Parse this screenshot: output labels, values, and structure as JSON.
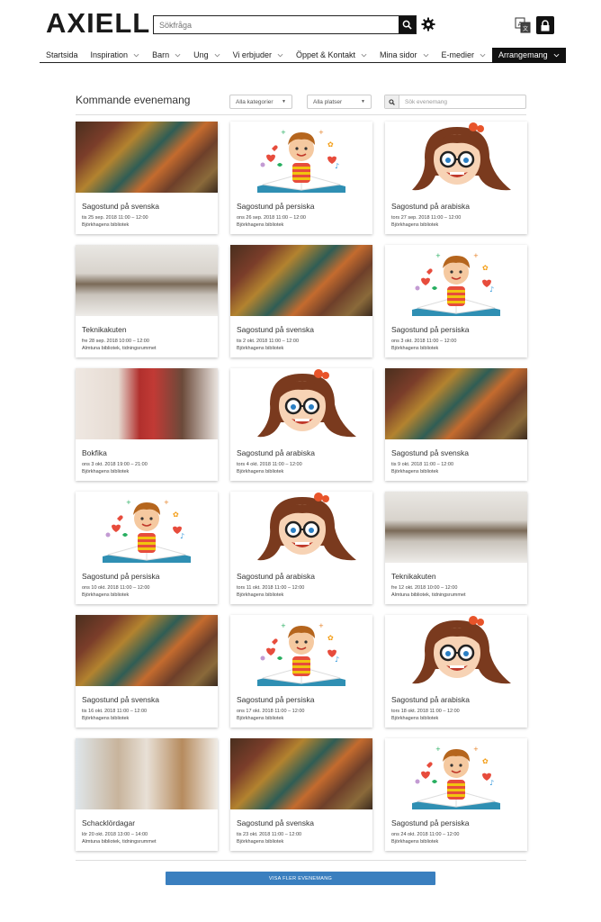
{
  "header": {
    "logo_text": "AXIELL",
    "search_placeholder": "Sökfråga",
    "icons": {
      "search": "search-icon",
      "settings": "gear-icon",
      "translate": "translate-icon",
      "login": "lock-icon"
    }
  },
  "nav": [
    {
      "label": "Startsida",
      "dropdown": false,
      "active": false
    },
    {
      "label": "Inspiration",
      "dropdown": true,
      "active": false
    },
    {
      "label": "Barn",
      "dropdown": true,
      "active": false
    },
    {
      "label": "Ung",
      "dropdown": true,
      "active": false
    },
    {
      "label": "Vi erbjuder",
      "dropdown": true,
      "active": false
    },
    {
      "label": "Öppet & Kontakt",
      "dropdown": true,
      "active": false
    },
    {
      "label": "Mina sidor",
      "dropdown": true,
      "active": false
    },
    {
      "label": "E-medier",
      "dropdown": true,
      "active": false
    },
    {
      "label": "Arrangemang",
      "dropdown": true,
      "active": true
    }
  ],
  "events": {
    "title": "Kommande evenemang",
    "filter_category": "Alla kategorier",
    "filter_place": "Alla platser",
    "search_placeholder": "Sök evenemang",
    "more_button": "VISA FLER EVENEMANG",
    "items": [
      {
        "title": "Sagostund på svenska",
        "date": "tis 25 sep. 2018 11:00 – 12:00",
        "place": "Björkhagens bibliotek",
        "image": "books"
      },
      {
        "title": "Sagostund på persiska",
        "date": "ons 26 sep. 2018 11:00 – 12:00",
        "place": "Björkhagens bibliotek",
        "image": "boy"
      },
      {
        "title": "Sagostund på arabiska",
        "date": "tors 27 sep. 2018 11:00 – 12:00",
        "place": "Björkhagens bibliotek",
        "image": "girl"
      },
      {
        "title": "Teknikakuten",
        "date": "fre 28 sep. 2018 10:00 – 12:00",
        "place": "Almtuna bibliotek, tidningsrummet",
        "image": "tech"
      },
      {
        "title": "Sagostund på svenska",
        "date": "tis 2 okt. 2018 11:00 – 12:00",
        "place": "Björkhagens bibliotek",
        "image": "books"
      },
      {
        "title": "Sagostund på persiska",
        "date": "ons 3 okt. 2018 11:00 – 12:00",
        "place": "Björkhagens bibliotek",
        "image": "boy"
      },
      {
        "title": "Bokfika",
        "date": "ons 3 okt. 2018 19:00 – 21:00",
        "place": "Björkhagens bibliotek",
        "image": "portrait"
      },
      {
        "title": "Sagostund på arabiska",
        "date": "tors 4 okt. 2018 11:00 – 12:00",
        "place": "Björkhagens bibliotek",
        "image": "girl"
      },
      {
        "title": "Sagostund på svenska",
        "date": "tis 9 okt. 2018 11:00 – 12:00",
        "place": "Björkhagens bibliotek",
        "image": "books"
      },
      {
        "title": "Sagostund på persiska",
        "date": "ons 10 okt. 2018 11:00 – 12:00",
        "place": "Björkhagens bibliotek",
        "image": "boy"
      },
      {
        "title": "Sagostund på arabiska",
        "date": "tors 11 okt. 2018 11:00 – 12:00",
        "place": "Björkhagens bibliotek",
        "image": "girl"
      },
      {
        "title": "Teknikakuten",
        "date": "fre 12 okt. 2018 10:00 – 12:00",
        "place": "Almtuna bibliotek, tidningsrummet",
        "image": "tech"
      },
      {
        "title": "Sagostund på svenska",
        "date": "tis 16 okt. 2018 11:00 – 12:00",
        "place": "Björkhagens bibliotek",
        "image": "books"
      },
      {
        "title": "Sagostund på persiska",
        "date": "ons 17 okt. 2018 11:00 – 12:00",
        "place": "Björkhagens bibliotek",
        "image": "boy"
      },
      {
        "title": "Sagostund på arabiska",
        "date": "tors 18 okt. 2018 11:00 – 12:00",
        "place": "Björkhagens bibliotek",
        "image": "girl"
      },
      {
        "title": "Schacklördagar",
        "date": "lör 20 okt. 2018 13:00 – 14:00",
        "place": "Almtuna bibliotek, tidningsrummet",
        "image": "chess"
      },
      {
        "title": "Sagostund på svenska",
        "date": "tis 23 okt. 2018 11:00 – 12:00",
        "place": "Björkhagens bibliotek",
        "image": "books"
      },
      {
        "title": "Sagostund på persiska",
        "date": "ons 24 okt. 2018 11:00 – 12:00",
        "place": "Björkhagens bibliotek",
        "image": "boy"
      }
    ]
  },
  "colors": {
    "accent": "#3a7fbf",
    "nav_active_bg": "#111111",
    "text": "#333333"
  }
}
